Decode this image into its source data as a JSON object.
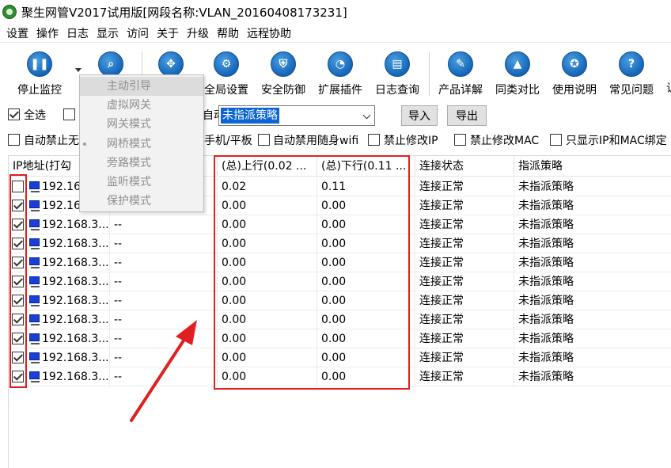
{
  "window": {
    "title": "聚生网管V2017试用版[网段名称:VLAN_20160408173231]"
  },
  "menu": [
    "设置",
    "操作",
    "日志",
    "显示",
    "访问",
    "关于",
    "升级",
    "帮助",
    "远程协助"
  ],
  "toolbar": {
    "buttons": [
      {
        "label": "停止监控",
        "icon": "pause-icon"
      },
      {
        "label": "",
        "icon": "search-icon"
      },
      {
        "label": "",
        "icon": "move-icon"
      },
      {
        "label": "全局设置",
        "icon": "gear-icon"
      },
      {
        "label": "安全防御",
        "icon": "shield-icon"
      },
      {
        "label": "扩展插件",
        "icon": "pie-chart-icon"
      },
      {
        "label": "日志查询",
        "icon": "log-book-icon"
      },
      {
        "label": "产品详解",
        "icon": "edit-icon"
      },
      {
        "label": "同类对比",
        "icon": "graduation-cap-icon"
      },
      {
        "label": "使用说明",
        "icon": "award-icon"
      },
      {
        "label": "常见问题",
        "icon": "question-icon"
      },
      {
        "label": "让",
        "icon": ""
      }
    ]
  },
  "mode_menu": {
    "items": [
      "主动引导",
      "虚拟网关",
      "网关模式",
      "网桥模式",
      "旁路模式",
      "监听模式",
      "保护模式"
    ],
    "selected_index": 3
  },
  "filter": {
    "select_all_label": "全选",
    "partial_label": "自动",
    "policy_value": "未指派策略",
    "import_label": "导入",
    "export_label": "导出"
  },
  "options": {
    "auto_ban_label": "自动禁止无",
    "mobile_label": "手机/平板",
    "auto_ban_wifi_label": "自动禁用随身wifi",
    "ban_ip_label": "禁止修改IP",
    "ban_mac_label": "禁止修改MAC",
    "ip_mac_label": "只显示IP和MAC绑定"
  },
  "table": {
    "headers": [
      "IP地址(打勾",
      "",
      "(总)上行(0.02 ...",
      "(总)下行(0.11 ...",
      "连接状态",
      "指派策略"
    ],
    "rows": [
      {
        "checked": false,
        "ip": "192.16",
        "name": "",
        "up": "0.02",
        "down": "0.11",
        "status": "连接正常",
        "policy": "未指派策略"
      },
      {
        "checked": true,
        "ip": "192.16",
        "name": "",
        "up": "0.00",
        "down": "0.00",
        "status": "连接正常",
        "policy": "未指派策略"
      },
      {
        "checked": true,
        "ip": "192.168.3...",
        "name": "--",
        "up": "0.00",
        "down": "0.00",
        "status": "连接正常",
        "policy": "未指派策略"
      },
      {
        "checked": true,
        "ip": "192.168.3...",
        "name": "--",
        "up": "0.00",
        "down": "0.00",
        "status": "连接正常",
        "policy": "未指派策略"
      },
      {
        "checked": true,
        "ip": "192.168.3...",
        "name": "--",
        "up": "0.00",
        "down": "0.00",
        "status": "连接正常",
        "policy": "未指派策略"
      },
      {
        "checked": true,
        "ip": "192.168.3...",
        "name": "--",
        "up": "0.00",
        "down": "0.00",
        "status": "连接正常",
        "policy": "未指派策略"
      },
      {
        "checked": true,
        "ip": "192.168.3...",
        "name": "--",
        "up": "0.00",
        "down": "0.00",
        "status": "连接正常",
        "policy": "未指派策略"
      },
      {
        "checked": true,
        "ip": "192.168.3...",
        "name": "--",
        "up": "0.00",
        "down": "0.00",
        "status": "连接正常",
        "policy": "未指派策略"
      },
      {
        "checked": true,
        "ip": "192.168.3...",
        "name": "--",
        "up": "0.00",
        "down": "0.00",
        "status": "连接正常",
        "policy": "未指派策略"
      },
      {
        "checked": true,
        "ip": "192.168.3...",
        "name": "--",
        "up": "0.00",
        "down": "0.00",
        "status": "连接正常",
        "policy": "未指派策略"
      },
      {
        "checked": true,
        "ip": "192.168.3...",
        "name": "--",
        "up": "0.00",
        "down": "0.00",
        "status": "连接正常",
        "policy": "未指派策略"
      }
    ]
  },
  "colors": {
    "highlight": "#e02020",
    "selection": "#0a64d6",
    "icon_blue": "#1565b8"
  }
}
